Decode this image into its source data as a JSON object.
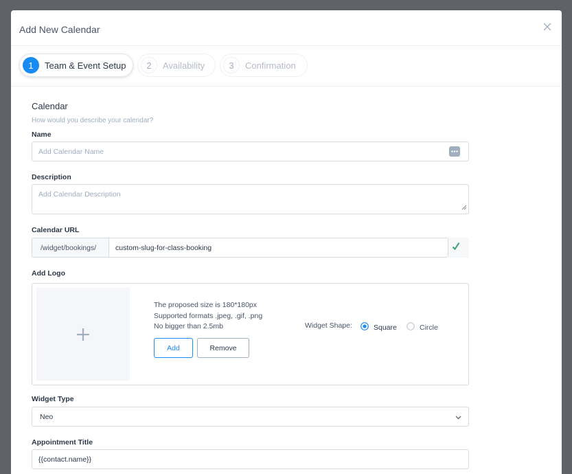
{
  "modal": {
    "title": "Add New Calendar"
  },
  "steps": [
    {
      "number": "1",
      "label": "Team & Event Setup",
      "active": true
    },
    {
      "number": "2",
      "label": "Availability",
      "active": false
    },
    {
      "number": "3",
      "label": "Confirmation",
      "active": false
    }
  ],
  "calendar_section": {
    "title": "Calendar",
    "subtitle": "How would you describe your calendar?"
  },
  "name_field": {
    "label": "Name",
    "placeholder": "Add Calendar Name",
    "value": ""
  },
  "description_field": {
    "label": "Description",
    "placeholder": "Add Calendar Description",
    "value": ""
  },
  "url_field": {
    "label": "Calendar URL",
    "prefix": "/widget/bookings/",
    "value": "custom-slug-for-class-booking",
    "status": "valid"
  },
  "logo": {
    "label": "Add Logo",
    "hint_size": "The proposed size is 180*180px",
    "hint_formats": "Supported formats .jpeg, .gif, .png",
    "hint_limit": "No bigger than 2.5mb",
    "add_label": "Add",
    "remove_label": "Remove",
    "shape_label": "Widget Shape:",
    "shape_options": [
      {
        "label": "Square",
        "selected": true
      },
      {
        "label": "Circle",
        "selected": false
      }
    ]
  },
  "widget_type": {
    "label": "Widget Type",
    "value": "Neo"
  },
  "appointment_title": {
    "label": "Appointment Title",
    "value": "{{contact.name}}"
  },
  "colors": {
    "primary": "#188bf6",
    "success": "#38a169"
  }
}
